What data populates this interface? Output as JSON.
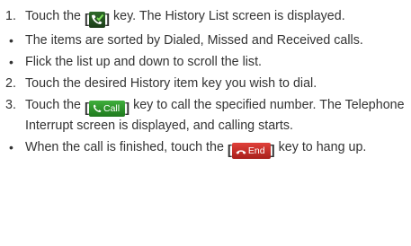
{
  "steps": [
    {
      "marker": "1.",
      "pre": "Touch the",
      "post": "key. The History List screen is displayed."
    },
    {
      "marker": "•",
      "text": "The items are sorted by Dialed, Missed and Received calls."
    },
    {
      "marker": "•",
      "text": "Flick the list up and down to scroll the list."
    },
    {
      "marker": "2.",
      "text": "Touch the desired History item key you wish to dial."
    },
    {
      "marker": "3.",
      "pre": "Touch the",
      "post": "key to call the specified number. The Telephone Interrupt screen is displayed, and calling starts."
    },
    {
      "marker": "•",
      "pre": "When the call is finished, touch the",
      "post": "key to hang up."
    }
  ],
  "keys": {
    "dialed_label": "Dialed",
    "call_label": "Call",
    "end_label": "End",
    "dialed_icon": "phone-check-icon",
    "call_icon": "phone-icon",
    "end_icon": "hang-up-icon",
    "call_color": "#2e9a2b",
    "end_color": "#c8302a",
    "bracket_open": "[",
    "bracket_close": "]"
  }
}
